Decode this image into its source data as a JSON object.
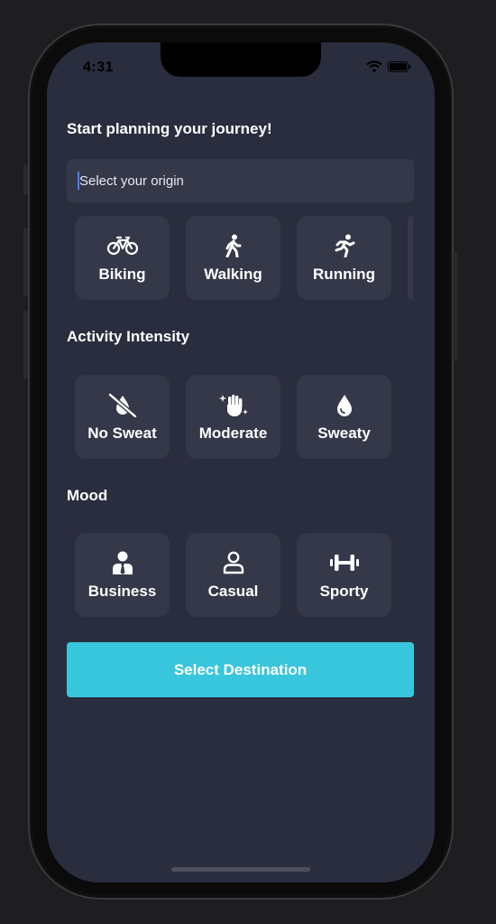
{
  "status": {
    "time": "4:31"
  },
  "headings": {
    "journey": "Start planning your journey!",
    "intensity": "Activity Intensity",
    "mood": "Mood"
  },
  "origin": {
    "value": "Select your origin"
  },
  "activities": [
    {
      "label": "Biking",
      "icon": "bicycle-icon"
    },
    {
      "label": "Walking",
      "icon": "walking-person-icon"
    },
    {
      "label": "Running",
      "icon": "running-person-icon"
    }
  ],
  "intensity": [
    {
      "label": "No Sweat",
      "icon": "no-drop-icon"
    },
    {
      "label": "Moderate",
      "icon": "sparkle-hand-icon"
    },
    {
      "label": "Sweaty",
      "icon": "drop-icon"
    }
  ],
  "mood": [
    {
      "label": "Business",
      "icon": "businessperson-icon"
    },
    {
      "label": "Casual",
      "icon": "person-outline-icon"
    },
    {
      "label": "Sporty",
      "icon": "dumbbell-icon"
    }
  ],
  "cta": {
    "label": "Select Destination"
  },
  "colors": {
    "screen_bg": "#2a2d3d",
    "tile_bg": "#343849",
    "accent": "#38c6dc"
  }
}
